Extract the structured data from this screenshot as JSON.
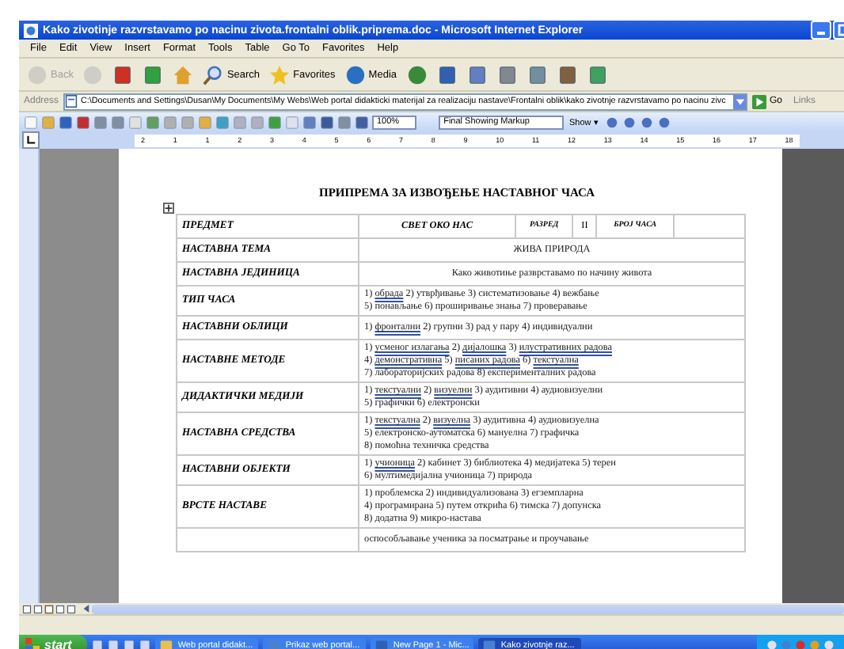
{
  "window": {
    "title": "Kako zivotinje razvrstavamo po nacinu zivota.frontalni oblik.priprema.doc - Microsoft Internet Explorer"
  },
  "menu": [
    "File",
    "Edit",
    "View",
    "Insert",
    "Format",
    "Tools",
    "Table",
    "Go To",
    "Favorites",
    "Help"
  ],
  "toolbar": [
    {
      "kind": "back",
      "label": "Back",
      "disabled": true
    },
    {
      "kind": "forward",
      "disabled": true
    },
    {
      "kind": "stop",
      "disabled": false
    },
    {
      "kind": "refresh",
      "disabled": false
    },
    {
      "kind": "home",
      "disabled": false
    },
    {
      "kind": "search",
      "label": "Search",
      "disabled": false
    },
    {
      "kind": "favorites",
      "label": "Favorites",
      "disabled": false
    },
    {
      "kind": "media",
      "label": "Media",
      "disabled": false
    },
    {
      "kind": "history",
      "disabled": false
    },
    {
      "kind": "word",
      "disabled": false
    },
    {
      "kind": "mail",
      "disabled": false
    },
    {
      "kind": "print",
      "disabled": false
    },
    {
      "kind": "edit",
      "disabled": false
    },
    {
      "kind": "discuss",
      "disabled": false
    },
    {
      "kind": "messenger",
      "disabled": false
    }
  ],
  "address": {
    "label": "Address",
    "value": "C:\\Documents and Settings\\Dusan\\My Documents\\My Webs\\Web portal didakticki materijal za realizaciju nastave\\Frontalni oblik\\kako zivotnje razvrstavamo po nacinu zivc",
    "go": "Go",
    "links": "Links"
  },
  "word_toolbar": {
    "zoom": "100%",
    "markup": "Final Showing Markup",
    "show": "Show ▾"
  },
  "ruler": [
    "2",
    "1",
    "1",
    "2",
    "3",
    "4",
    "5",
    "6",
    "7",
    "8",
    "9",
    "10",
    "11",
    "12",
    "13",
    "14",
    "15",
    "16",
    "17",
    "18"
  ],
  "document": {
    "heading": "ПРИПРЕМА ЗА ИЗВОЂЕЊЕ НАСТАВНОГ ЧАСА",
    "header_row": [
      {
        "text": "ПРЕДМЕТ",
        "kind": "label"
      },
      {
        "text": "СВЕТ ОКО НАС",
        "kind": "subject"
      },
      {
        "text": "РАЗРЕД",
        "kind": "small"
      },
      {
        "text": "II",
        "kind": "plain"
      },
      {
        "text": "БРОЈ ЧАСА",
        "kind": "small"
      },
      {
        "kind": "empty"
      }
    ],
    "rows": [
      {
        "label": "НАСТАВНА ТЕМА",
        "kind": "title",
        "lines": [
          [
            {
              "term": "ЖИВА ПРИРОДА",
              "underlined": false
            }
          ]
        ]
      },
      {
        "label": "НАСТАВНА ЈЕДИНИЦА",
        "kind": "title",
        "lines": [
          [
            {
              "term": "Како животиње разврставамо по начину живота",
              "underlined": false
            }
          ]
        ]
      },
      {
        "label": "ТИП ЧАСА",
        "kind": "list",
        "lines": [
          [
            {
              "number": "1)",
              "term": "обрада",
              "underlined": true
            },
            {
              "number": "2)",
              "term": "утврђивање",
              "underlined": false
            },
            {
              "number": "3)",
              "term": "систематизовање",
              "underlined": false
            },
            {
              "number": "4)",
              "term": "вежбање",
              "underlined": false
            }
          ],
          [
            {
              "number": "5)",
              "term": "понављање",
              "underlined": false
            },
            {
              "number": "6)",
              "term": "проширивање знања",
              "underlined": false
            },
            {
              "number": "7)",
              "term": "проверавање",
              "underlined": false
            }
          ]
        ]
      },
      {
        "label": "НАСТАВНИ ОБЛИЦИ",
        "kind": "list",
        "lines": [
          [
            {
              "number": "1)",
              "term": "фронтални",
              "underlined": true
            },
            {
              "number": "2)",
              "term": "групни",
              "underlined": false
            },
            {
              "number": "3)",
              "term": "рад у пару",
              "underlined": false
            },
            {
              "number": "4)",
              "term": "индивидуални",
              "underlined": false
            }
          ]
        ]
      },
      {
        "label": "НАСТАВНЕ МЕТОДЕ",
        "kind": "list",
        "lines": [
          [
            {
              "number": "1)",
              "term": "усменог излагања",
              "underlined": true
            },
            {
              "number": "2)",
              "term": "дијалошка",
              "underlined": true
            },
            {
              "number": "3)",
              "term": "илустративних радова",
              "underlined": true
            }
          ],
          [
            {
              "number": "4)",
              "term": "демонстративна",
              "underlined": true
            },
            {
              "number": "5)",
              "term": "писаних радова",
              "underlined": true
            },
            {
              "number": "6)",
              "term": "текстуална",
              "underlined": true
            }
          ],
          [
            {
              "number": "7)",
              "term": "лабораторијских радова",
              "underlined": false
            },
            {
              "number": "8)",
              "term": "експерименталних радова",
              "underlined": false
            }
          ]
        ]
      },
      {
        "label": "ДИДАКТИЧКИ МЕДИЈИ",
        "kind": "list",
        "lines": [
          [
            {
              "number": "1)",
              "term": "текстуални",
              "underlined": true
            },
            {
              "number": "2)",
              "term": "визуелни",
              "underlined": true
            },
            {
              "number": "3)",
              "term": "аудитивни",
              "underlined": false
            },
            {
              "number": "4)",
              "term": "аудиовизуелни",
              "underlined": false
            }
          ],
          [
            {
              "number": "5)",
              "term": "графички",
              "underlined": false
            },
            {
              "number": "6)",
              "term": "електронски",
              "underlined": false
            }
          ]
        ]
      },
      {
        "label": "НАСТАВНА СРЕДСТВА",
        "kind": "list",
        "lines": [
          [
            {
              "number": "1)",
              "term": "текстуална",
              "underlined": true
            },
            {
              "number": "2)",
              "term": "визуелна",
              "underlined": true
            },
            {
              "number": "3)",
              "term": "аудитивна",
              "underlined": false
            },
            {
              "number": "4)",
              "term": "аудиовизуелна",
              "underlined": false
            }
          ],
          [
            {
              "number": "5)",
              "term": "електронско-аутоматска",
              "underlined": false
            },
            {
              "number": "6)",
              "term": "мануелна",
              "underlined": false
            },
            {
              "number": "7)",
              "term": "графичка",
              "underlined": false
            }
          ],
          [
            {
              "number": "8)",
              "term": "помоћна техничка средства",
              "underlined": false
            }
          ]
        ]
      },
      {
        "label": "НАСТАВНИ ОБЈЕКТИ",
        "kind": "list",
        "lines": [
          [
            {
              "number": "1)",
              "term": "учионица",
              "underlined": true
            },
            {
              "number": "2)",
              "term": "кабинет",
              "underlined": false
            },
            {
              "number": "3)",
              "term": "библиотека",
              "underlined": false
            },
            {
              "number": "4)",
              "term": "медијатека",
              "underlined": false
            },
            {
              "number": "5)",
              "term": "терен",
              "underlined": false
            }
          ],
          [
            {
              "number": "6)",
              "term": "мултимедијална учионица",
              "underlined": false
            },
            {
              "number": "7)",
              "term": "природа",
              "underlined": false
            }
          ]
        ]
      },
      {
        "label": "ВРСТЕ НАСТАВЕ",
        "kind": "list",
        "lines": [
          [
            {
              "number": "1)",
              "term": "проблемска",
              "underlined": false
            },
            {
              "number": "2)",
              "term": "индивидуализована",
              "underlined": false
            },
            {
              "number": "3)",
              "term": "егземпларна",
              "underlined": false
            }
          ],
          [
            {
              "number": "4)",
              "term": "програмирана",
              "underlined": false
            },
            {
              "number": "5)",
              "term": "путем открића",
              "underlined": false
            },
            {
              "number": "6)",
              "term": "тимска",
              "underlined": false
            },
            {
              "number": "7)",
              "term": "допунска",
              "underlined": false
            }
          ],
          [
            {
              "number": "8)",
              "term": "додатна",
              "underlined": false
            },
            {
              "number": "9)",
              "term": "микро-настава",
              "underlined": false
            }
          ]
        ]
      },
      {
        "label": "",
        "kind": "list",
        "lines": [
          [
            {
              "term": "оспособљавање ученика за посматрање и проучавање",
              "underlined": false
            }
          ]
        ]
      }
    ]
  },
  "taskbar": {
    "start": "start",
    "tasks": [
      {
        "label": "Web portal didakt...",
        "kind": "folder",
        "selected": false
      },
      {
        "label": "Prikaz web portal...",
        "kind": "ie",
        "selected": false
      },
      {
        "label": "New Page 1 - Mic...",
        "kind": "frontpage",
        "selected": false
      },
      {
        "label": "Kako zivotnje raz...",
        "kind": "ie",
        "selected": true
      }
    ]
  }
}
